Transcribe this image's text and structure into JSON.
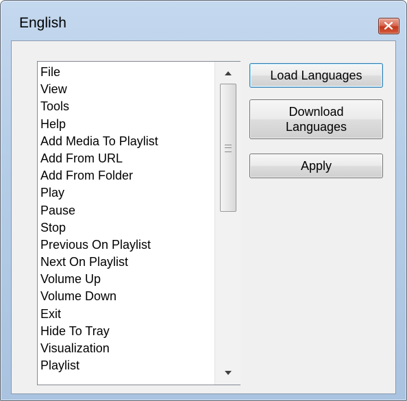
{
  "window": {
    "title": "English"
  },
  "list": {
    "items": [
      "File",
      "View",
      "Tools",
      "Help",
      "Add Media To Playlist",
      "Add From URL",
      "Add From Folder",
      "Play",
      "Pause",
      "Stop",
      "Previous On Playlist",
      "Next On Playlist",
      "Volume Up",
      "Volume Down",
      "Exit",
      "Hide To Tray",
      "Visualization",
      "Playlist"
    ]
  },
  "buttons": {
    "load": "Load Languages",
    "download_line1": "Download",
    "download_line2": "Languages",
    "apply": "Apply"
  },
  "icons": {
    "close": "close-icon",
    "scroll_up": "arrow-up-icon",
    "scroll_down": "arrow-down-icon",
    "grip": "scroll-grip-icon"
  },
  "colors": {
    "close_button": "#c4381d",
    "frame": "#b5cde7",
    "client": "#f0f0f0"
  }
}
